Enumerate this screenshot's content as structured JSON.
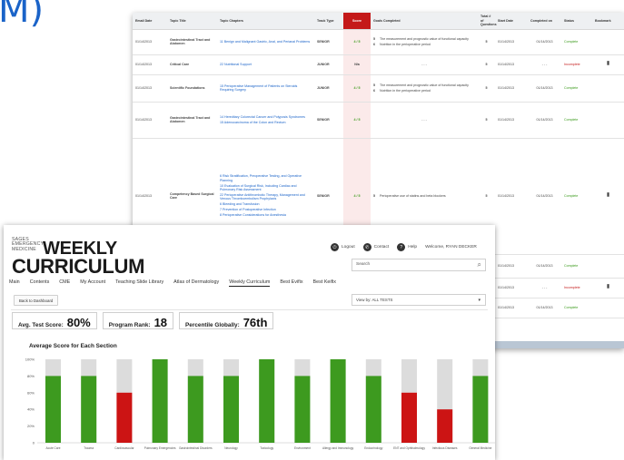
{
  "corner_glyph": "M)",
  "table": {
    "columns": [
      "Email Date",
      "Topic Title",
      "Topic Chapters",
      "Track Type",
      "Score",
      "Goals Completed",
      "Total # of Questions",
      "Start Date",
      "Completed on",
      "Status",
      "Bookmark"
    ],
    "rows": [
      {
        "date": "01/14/2013",
        "title": "Gastrointestinal Tract and Abdomen",
        "chapters": [
          "11 Benign and Malignant Gastric, Anal, and Perianal Problems"
        ],
        "track": "SENIOR",
        "score": "4 / 5",
        "goals": [
          {
            "letter": "5",
            "text": "The measurement and prognostic value of functional capacity"
          },
          {
            "letter": "6",
            "text": "Nutrition in the perioperative period"
          }
        ],
        "total": "5",
        "start": "01/14/2013",
        "completed": "01/14/2013",
        "status": "Complete",
        "status_kind": "complete",
        "bookmark": false
      },
      {
        "date": "01/14/2013",
        "title": "Critical Care",
        "chapters": [
          "22 Nutritional Support"
        ],
        "track": "JUNIOR",
        "score": "N/a",
        "goals": [
          {
            "letter": "",
            "text": "- - -"
          }
        ],
        "total": "5",
        "start": "01/14/2013",
        "completed": "- - -",
        "status": "Incomplete",
        "status_kind": "incomplete",
        "bookmark": true
      },
      {
        "date": "01/14/2013",
        "title": "Scientific Foundations",
        "chapters": [
          "15 Perioperative Management of Patients on Steroids Requiring Surgery"
        ],
        "track": "JUNIOR",
        "score": "4 / 5",
        "goals": [
          {
            "letter": "5",
            "text": "The measurement and prognostic value of functional capacity"
          },
          {
            "letter": "6",
            "text": "Nutrition in the perioperative period"
          }
        ],
        "total": "5",
        "start": "01/14/2013",
        "completed": "01/14/2013",
        "status": "Complete",
        "status_kind": "complete",
        "bookmark": false
      },
      {
        "date": "01/14/2013",
        "title": "Gastrointestinal Tract and Abdomen",
        "chapters": [
          "14 Hereditary Colorectal Cancer and Polyposis Syndromes",
          "15 Adenocarcinoma of the Colon and Rectum"
        ],
        "track": "SENIOR",
        "score": "4 / 5",
        "goals": [
          {
            "letter": "",
            "text": "- - -"
          }
        ],
        "total": "5",
        "start": "01/14/2013",
        "completed": "01/14/2013",
        "status": "Complete",
        "status_kind": "complete",
        "bookmark": false
      },
      {
        "date": "01/14/2013",
        "title": "Competency Based Surgical Care",
        "chapters": [
          "6 Risk Stratification, Preoperative Testing, and Operative Planning",
          "10 Evaluation of Surgical Risk, Including Cardiac and Pulmonary Risk Assessment",
          "22 Perioperative Antithrombotic Therapy, Management and Venous Thromboembolism Prophylaxis",
          "6 Bleeding and Transfusion",
          "7 Prevention of Postoperative Infection",
          "8 Perioperative Considerations for Anesthesia"
        ],
        "track": "SENIOR",
        "score": "4 / 5",
        "goals": [
          {
            "letter": "5",
            "text": "Perioperative use of statins and beta blockers"
          }
        ],
        "total": "5",
        "start": "01/14/2013",
        "completed": "01/14/2013",
        "status": "Complete",
        "status_kind": "complete",
        "bookmark": true
      },
      {
        "date": "01/14/2013",
        "title": "",
        "chapters": [],
        "track": "",
        "score": "",
        "goals": [],
        "total": "",
        "start": "01/14/2013",
        "completed": "01/14/2013",
        "status": "Complete",
        "status_kind": "complete",
        "bookmark": false
      },
      {
        "date": "01/14/2013",
        "title": "",
        "chapters": [],
        "track": "",
        "score": "",
        "goals": [],
        "total": "",
        "start": "01/14/2013",
        "completed": "- - -",
        "status": "Incomplete",
        "status_kind": "incomplete",
        "bookmark": true
      },
      {
        "date": "01/14/2013",
        "title": "",
        "chapters": [],
        "track": "",
        "score": "",
        "goals": [],
        "total": "",
        "start": "01/14/2013",
        "completed": "01/14/2013",
        "status": "Complete",
        "status_kind": "complete",
        "bookmark": false
      }
    ]
  },
  "logo": {
    "small": "SAGES EMERGENCY MEDICINE",
    "weekly": "WEEKLY",
    "curriculum": "CURRICULUM"
  },
  "utility": {
    "logout": "Logout",
    "contact": "Contact",
    "help": "Help",
    "welcome": "Welcome, RYAN DECKER"
  },
  "search": {
    "placeholder": "Search"
  },
  "nav": [
    "Main",
    "Contents",
    "CME",
    "My Account",
    "Teaching Slide Library",
    "Atlas of Dermatology",
    "Weekly Curriculum",
    "Best Evifix",
    "Best Keifix"
  ],
  "nav_active": "Weekly Curriculum",
  "back_button": "Back to Dashboard",
  "view_by": "View by:  ALL TESTS",
  "stats": [
    {
      "label": "Avg. Test Score:",
      "value": "80%"
    },
    {
      "label": "Program Rank:",
      "value": "18"
    },
    {
      "label": "Percentile Globally:",
      "value": "76th"
    }
  ],
  "colors": {
    "pass": "#3d9a1f",
    "fail": "#cc1414",
    "track": "#dcdcdc",
    "link": "#1a63c8",
    "accent": "#c41919"
  },
  "chart_data": {
    "type": "bar",
    "title": "Average Score for Each Section",
    "ylim": [
      0,
      100
    ],
    "yticks": [
      "0",
      "20%",
      "40%",
      "60%",
      "80%",
      "100%"
    ],
    "grid": false,
    "categories": [
      "Acute Care",
      "Trauma",
      "Cardiovascular",
      "Pulmonary Emergencies",
      "Gastrointestinal Disorders",
      "Neurology",
      "Toxicology",
      "Environment",
      "Allergy and Immunology",
      "Endocrinology",
      "ENT and Ophthalmology",
      "Infectious Diseases",
      "General Medicine"
    ],
    "values": [
      80,
      80,
      60,
      100,
      80,
      80,
      100,
      80,
      100,
      80,
      60,
      40,
      80
    ],
    "status": [
      "pass",
      "pass",
      "fail",
      "pass",
      "pass",
      "pass",
      "pass",
      "pass",
      "pass",
      "pass",
      "fail",
      "fail",
      "pass"
    ]
  }
}
